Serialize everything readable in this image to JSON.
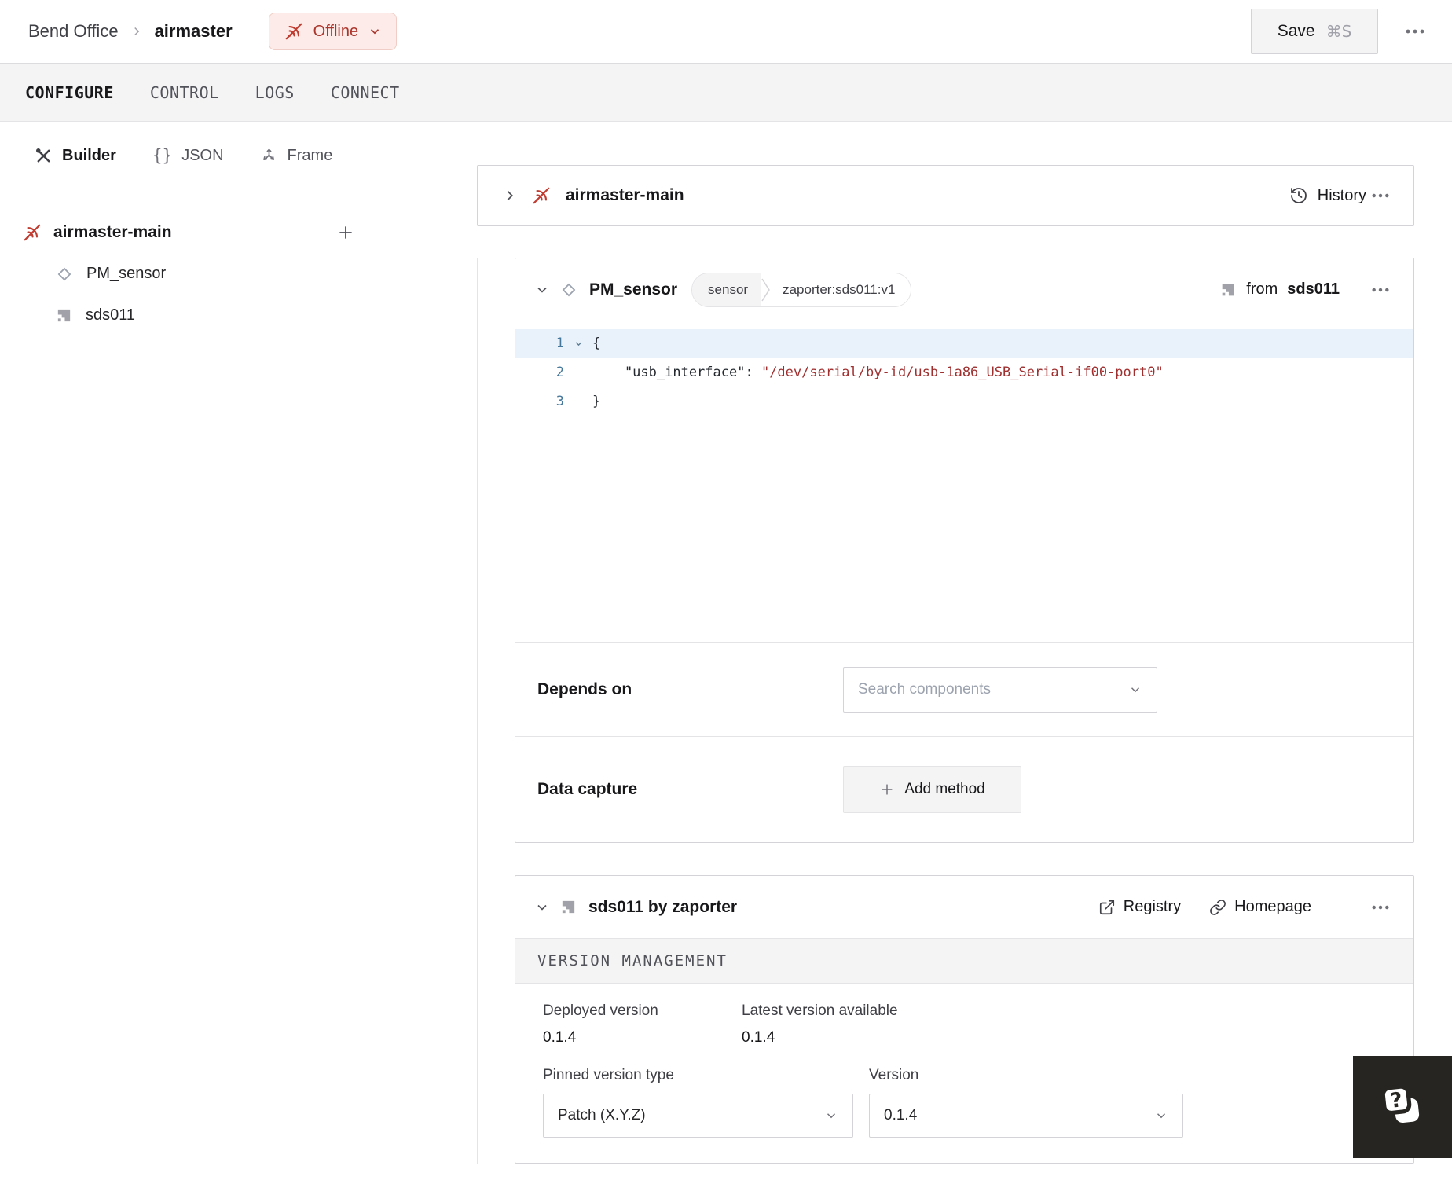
{
  "header": {
    "breadcrumb": {
      "org": "Bend Office",
      "machine": "airmaster"
    },
    "status_badge": {
      "label": "Offline"
    },
    "save_button": {
      "label": "Save",
      "shortcut": "⌘S"
    }
  },
  "tabs": [
    {
      "label": "CONFIGURE"
    },
    {
      "label": "CONTROL"
    },
    {
      "label": "LOGS"
    },
    {
      "label": "CONNECT"
    }
  ],
  "sidebar": {
    "modes": [
      {
        "label": "Builder"
      },
      {
        "label": "JSON",
        "glyph": "{}"
      },
      {
        "label": "Frame"
      }
    ],
    "tree": [
      {
        "label": "airmaster-main"
      },
      {
        "label": "PM_sensor"
      },
      {
        "label": "sds011"
      }
    ]
  },
  "part_card": {
    "title": "airmaster-main",
    "history_label": "History"
  },
  "component_card": {
    "title": "PM_sensor",
    "type_tag": "sensor",
    "model_tag": "zaporter:sds011:v1",
    "from_prefix": "from",
    "from_module": "sds011",
    "code": {
      "line_numbers": [
        "1",
        "2",
        "3"
      ],
      "line1": "{",
      "line2_key": "    \"usb_interface\"",
      "line2_colon": ": ",
      "line2_value": "\"/dev/serial/by-id/usb-1a86_USB_Serial-if00-port0\"",
      "line3": "}"
    },
    "depends_on": {
      "label": "Depends on",
      "placeholder": "Search components"
    },
    "data_capture": {
      "label": "Data capture",
      "button_label": "Add method"
    }
  },
  "module_card": {
    "title": "sds011 by zaporter",
    "registry_label": "Registry",
    "homepage_label": "Homepage",
    "section_title": "VERSION MANAGEMENT",
    "deployed_version": {
      "label": "Deployed version",
      "value": "0.1.4"
    },
    "latest_version": {
      "label": "Latest version available",
      "value": "0.1.4"
    },
    "pinned_type": {
      "label": "Pinned version type",
      "value": "Patch (X.Y.Z)"
    },
    "version": {
      "label": "Version",
      "value": "0.1.4"
    }
  },
  "help": {
    "glyph": "?"
  },
  "colors": {
    "danger_text": "#ab352c",
    "danger_bg": "#fcebe8",
    "border": "#e4e4e7",
    "code_string": "#a03030",
    "line_number": "#45789b",
    "active_line_bg": "#e9f2fb"
  }
}
